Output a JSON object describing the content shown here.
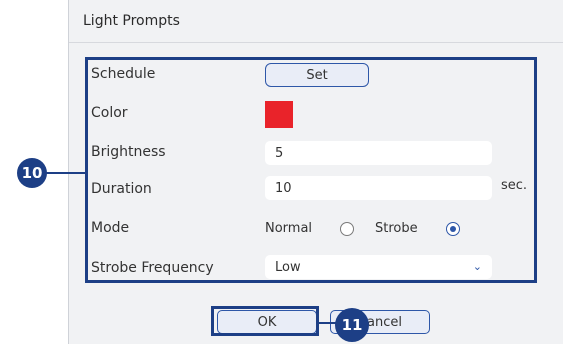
{
  "dialog": {
    "title": "Light Prompts"
  },
  "fields": {
    "schedule": {
      "label": "Schedule",
      "button_label": "Set"
    },
    "color": {
      "label": "Color",
      "value_color": "#e9232a"
    },
    "brightness": {
      "label": "Brightness",
      "value": "5"
    },
    "duration": {
      "label": "Duration",
      "value": "10",
      "unit": "sec."
    },
    "mode": {
      "label": "Mode",
      "options": [
        "Normal",
        "Strobe"
      ],
      "selected": "Strobe"
    },
    "strobe_frequency": {
      "label": "Strobe Frequency",
      "value": "Low"
    }
  },
  "buttons": {
    "ok": "OK",
    "cancel": "Cancel"
  },
  "callouts": {
    "settings": "10",
    "ok": "11"
  },
  "colors": {
    "accent": "#1d3f86",
    "link": "#2e57a8"
  }
}
